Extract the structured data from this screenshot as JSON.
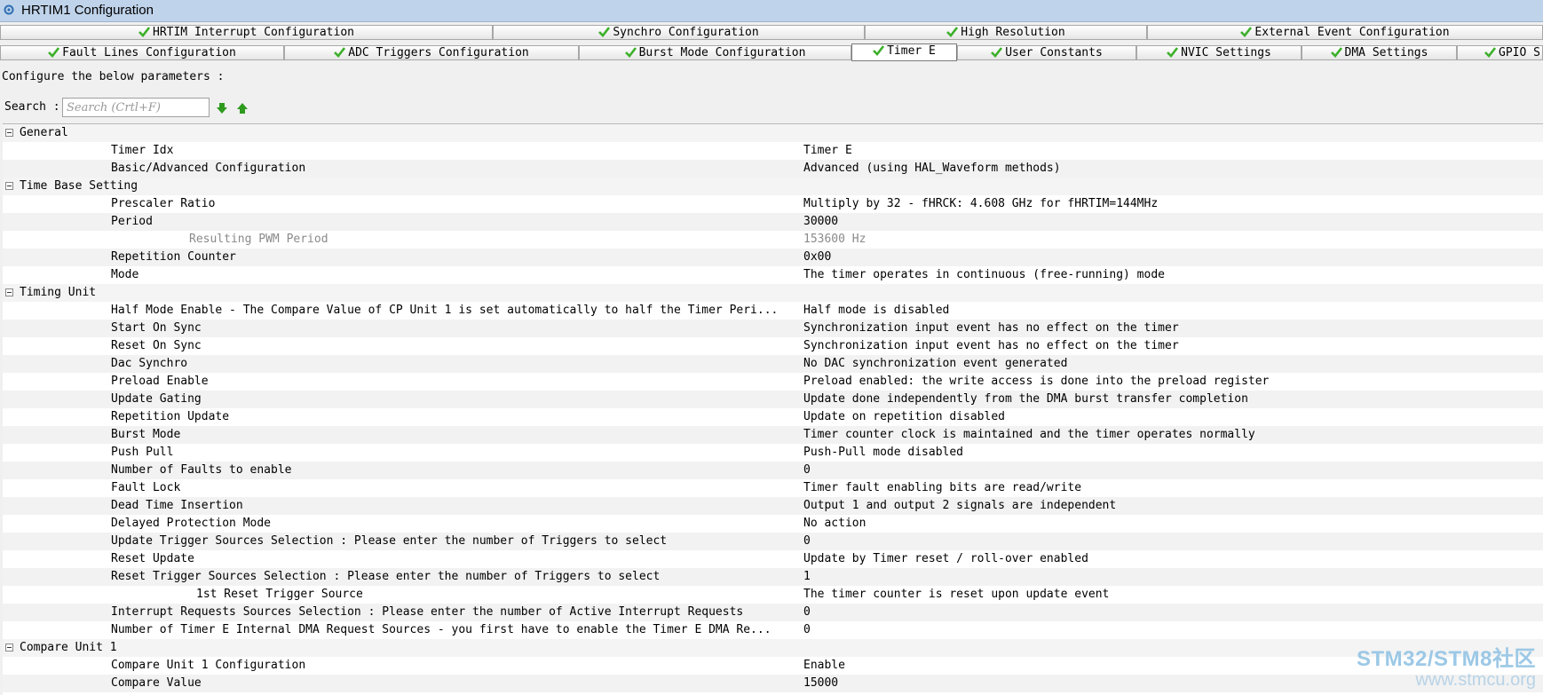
{
  "window": {
    "title": "HRTIM1 Configuration"
  },
  "tabs_row1": [
    {
      "label": "HRTIM Interrupt Configuration"
    },
    {
      "label": "Synchro Configuration"
    },
    {
      "label": "High Resolution"
    },
    {
      "label": "External Event Configuration"
    }
  ],
  "tabs_row2": [
    {
      "label": "Fault Lines Configuration"
    },
    {
      "label": "ADC Triggers Configuration"
    },
    {
      "label": "Burst Mode Configuration"
    },
    {
      "label": "Timer E",
      "active": true
    },
    {
      "label": "User Constants"
    },
    {
      "label": "NVIC Settings"
    },
    {
      "label": "DMA Settings"
    },
    {
      "label": "GPIO S"
    }
  ],
  "form": {
    "prompt": "Configure the below parameters :",
    "search_label": "Search :",
    "search_placeholder": "Search (Crtl+F)"
  },
  "rows": [
    {
      "type": "category",
      "label": "General"
    },
    {
      "name": "Timer Idx",
      "value": "Timer E"
    },
    {
      "name": "Basic/Advanced Configuration",
      "value": "Advanced (using HAL_Waveform methods)"
    },
    {
      "type": "category",
      "label": "Time Base Setting"
    },
    {
      "name": "Prescaler Ratio",
      "value": "Multiply by 32 - fHRCK: 4.608 GHz for fHRTIM=144MHz"
    },
    {
      "name": "Period",
      "value": "30000"
    },
    {
      "name": "Resulting PWM Period",
      "value": "153600 Hz",
      "indent": "sub",
      "readonly": true
    },
    {
      "name": "Repetition Counter",
      "value": "0x00"
    },
    {
      "name": "Mode",
      "value": "The timer operates in continuous (free-running) mode"
    },
    {
      "type": "category",
      "label": "Timing Unit"
    },
    {
      "name": "Half Mode Enable - The Compare Value of CP Unit 1 is set automatically to half the Timer Peri...",
      "value": "Half mode is disabled"
    },
    {
      "name": "Start On Sync",
      "value": "Synchronization input event has no effect on the timer"
    },
    {
      "name": "Reset On Sync",
      "value": "Synchronization input event has no effect on the timer"
    },
    {
      "name": "Dac Synchro",
      "value": "No DAC synchronization event generated"
    },
    {
      "name": "Preload Enable",
      "value": "Preload enabled: the write access is done into the preload register"
    },
    {
      "name": "Update Gating",
      "value": "Update done independently from the DMA burst transfer completion"
    },
    {
      "name": "Repetition Update",
      "value": "Update on repetition disabled"
    },
    {
      "name": "Burst Mode",
      "value": "Timer counter clock is maintained and the timer operates normally"
    },
    {
      "name": "Push Pull",
      "value": "Push-Pull mode disabled"
    },
    {
      "name": "Number of Faults to enable",
      "value": "0"
    },
    {
      "name": "Fault Lock",
      "value": "Timer fault enabling bits are read/write"
    },
    {
      "name": "Dead Time Insertion",
      "value": "Output 1 and output 2 signals are independent"
    },
    {
      "name": "Delayed Protection Mode",
      "value": "No action"
    },
    {
      "name": "Update Trigger Sources Selection : Please enter the number of Triggers to select",
      "value": "0"
    },
    {
      "name": "Reset Update",
      "value": "Update by Timer reset / roll-over enabled"
    },
    {
      "name": "Reset Trigger Sources Selection : Please enter the number of Triggers to select",
      "value": "1"
    },
    {
      "name": "1st Reset Trigger Source",
      "value": "The timer counter is reset upon update event",
      "indent": "sub2"
    },
    {
      "name": "Interrupt Requests Sources Selection : Please enter the number of Active Interrupt Requests",
      "value": "0"
    },
    {
      "name": "Number of Timer E Internal DMA Request Sources  - you first have to enable the Timer E DMA Re...",
      "value": "0"
    },
    {
      "type": "category",
      "label": "Compare Unit 1"
    },
    {
      "name": "Compare Unit 1 Configuration",
      "value": "Enable"
    },
    {
      "name": "Compare Value",
      "value": "15000"
    }
  ],
  "watermark": {
    "line1": "STM32/STM8社区",
    "line2": "www.stmcu.org"
  },
  "colors": {
    "check": "#3cb02a",
    "nav_arrow": "#2e9a1e",
    "title_bar": "#bfd3ea"
  }
}
